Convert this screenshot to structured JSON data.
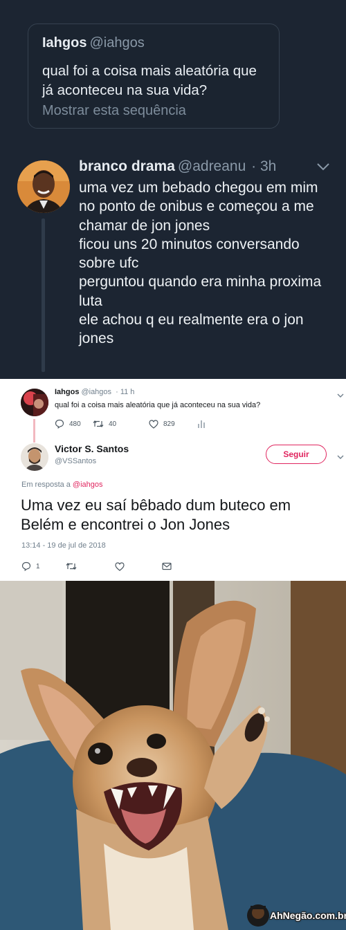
{
  "dark_tweet": {
    "quoted": {
      "name": "Iahgos",
      "handle": "@iahgos",
      "text": "qual foi a coisa mais aleatória que já aconteceu na sua vida?",
      "show_thread": "Mostrar esta sequência"
    },
    "reply": {
      "name": "branco drama",
      "handle": "@adreanu",
      "time": "· 3h",
      "lines": [
        "uma vez um bebado chegou em mim no ponto de onibus e começou a me chamar de jon jones",
        "ficou uns 20 minutos conversando sobre ufc",
        "perguntou quando era minha proxima luta",
        "ele achou q eu realmente era o jon jones"
      ]
    },
    "colors": {
      "background": "#1c2532",
      "text": "#e7ecf1",
      "muted": "#8a99a8"
    }
  },
  "light_tweet": {
    "original": {
      "name": "Iahgos",
      "handle": "@iahgos",
      "time": "· 11 h",
      "text": "qual foi a coisa mais aleatória que já aconteceu na sua vida?",
      "replies": "480",
      "retweets": "40",
      "likes": "829"
    },
    "reply": {
      "name": "Victor S. Santos",
      "handle": "@VSSantos",
      "follow_label": "Seguir",
      "in_reply_prefix": "Em resposta a",
      "in_reply_handle": "@iahgos",
      "text": "Uma vez eu saí bêbado dum buteco em Belém e encontrei o Jon Jones",
      "timestamp": "13:14 - 19 de jul de 2018",
      "replies": "1"
    },
    "colors": {
      "accent": "#e0245e",
      "muted": "#707f8c"
    }
  },
  "meme": {
    "watermark": "AhNegão.com.br"
  }
}
